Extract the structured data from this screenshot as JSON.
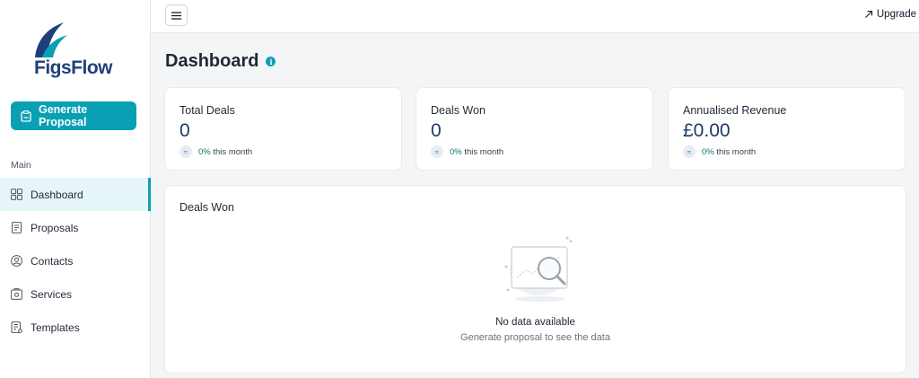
{
  "app": {
    "name": "FigsFlow"
  },
  "sidebar": {
    "cta_label": "Generate Proposal",
    "section_label": "Main",
    "items": [
      {
        "label": "Dashboard",
        "icon": "grid-icon",
        "active": true
      },
      {
        "label": "Proposals",
        "icon": "document-icon",
        "active": false
      },
      {
        "label": "Contacts",
        "icon": "user-circle-icon",
        "active": false
      },
      {
        "label": "Services",
        "icon": "services-icon",
        "active": false
      },
      {
        "label": "Templates",
        "icon": "template-icon",
        "active": false
      }
    ]
  },
  "topbar": {
    "upgrade_label": "Upgrade"
  },
  "page": {
    "title": "Dashboard"
  },
  "stats": [
    {
      "title": "Total Deals",
      "value": "0",
      "trend_pct": "0%",
      "trend_text": "this month"
    },
    {
      "title": "Deals Won",
      "value": "0",
      "trend_pct": "0%",
      "trend_text": "this month"
    },
    {
      "title": "Annualised Revenue",
      "value": "£0.00",
      "trend_pct": "0%",
      "trend_text": "this month"
    }
  ],
  "chart": {
    "title": "Deals Won",
    "empty_title": "No data available",
    "empty_subtitle": "Generate proposal to see the data"
  },
  "colors": {
    "accent": "#0aa0b3",
    "brand": "#1f3f7a",
    "active_bg": "#e6f6f8"
  }
}
